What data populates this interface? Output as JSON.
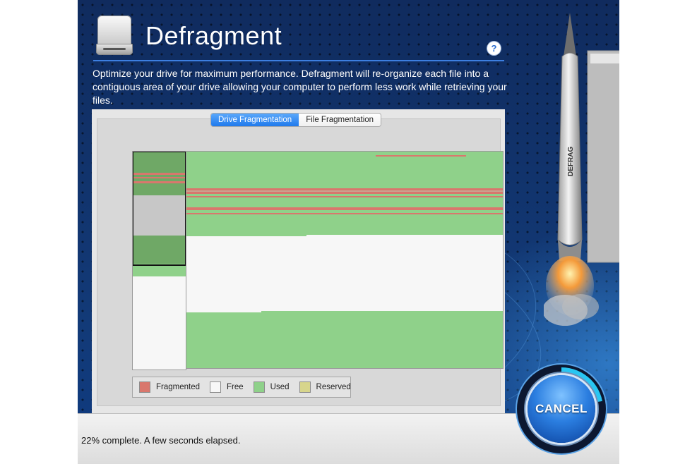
{
  "app": {
    "title": "Defragment",
    "description": "Optimize your drive for maximum performance. Defragment will re-organize each file into a contiguous area of your drive allowing your computer to perform less work while retrieving your files.",
    "help_label": "?"
  },
  "tabs": [
    {
      "label": "Drive Fragmentation",
      "active": true
    },
    {
      "label": "File Fragmentation",
      "active": false
    }
  ],
  "legend": [
    {
      "label": "Fragmented",
      "color": "#d9776d"
    },
    {
      "label": "Free",
      "color": "#f7f7f7"
    },
    {
      "label": "Used",
      "color": "#8fd18a"
    },
    {
      "label": "Reserved",
      "color": "#d7d58c"
    }
  ],
  "colors": {
    "fragmented": "#d9776d",
    "free": "#f7f7f7",
    "used": "#8fd18a",
    "reserved": "#d7d58c",
    "accent": "#1f79ec",
    "background": "#102b5e"
  },
  "rocket": {
    "label": "DEFRAG"
  },
  "status": {
    "text": "22% complete. A few seconds elapsed.",
    "progress_fraction": 0.22
  },
  "cancel": {
    "label": "CANCEL"
  }
}
